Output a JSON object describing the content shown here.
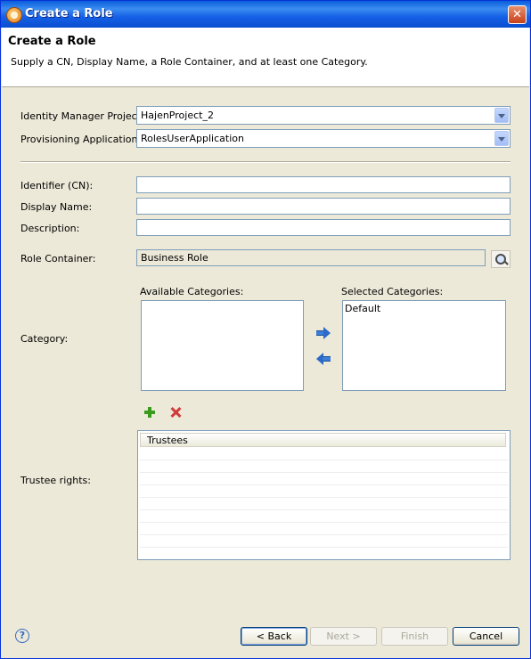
{
  "window": {
    "title": "Create a Role",
    "close_glyph": "✕"
  },
  "header": {
    "title": "Create a Role",
    "description": "Supply a CN, Display Name, a Role Container, and at least one Category."
  },
  "form": {
    "project_label": "Identity Manager Project:",
    "project_value": "HajenProject_2",
    "application_label": "Provisioning Application:",
    "application_value": "RolesUserApplication",
    "identifier_label": "Identifier (CN):",
    "identifier_value": "",
    "display_name_label": "Display Name:",
    "display_name_value": "",
    "description_label": "Description:",
    "description_value": "",
    "container_label": "Role Container:",
    "container_value": "Business Role",
    "category_label": "Category:",
    "available_categories_label": "Available Categories:",
    "selected_categories_label": "Selected Categories:",
    "available_categories": [],
    "selected_categories": [
      "Default"
    ],
    "trustee_label": "Trustee rights:",
    "trustees_column": "Trustees",
    "trustees": []
  },
  "icons": {
    "app": "novell-app-icon",
    "search": "magnifier-icon",
    "add_category": "arrow-right-icon",
    "remove_category": "arrow-left-icon",
    "add_trustee": "plus-icon",
    "remove_trustee": "delete-x-icon",
    "help": "help-icon"
  },
  "buttons": {
    "help_glyph": "?",
    "back": "< Back",
    "next": "Next >",
    "finish": "Finish",
    "cancel": "Cancel"
  }
}
